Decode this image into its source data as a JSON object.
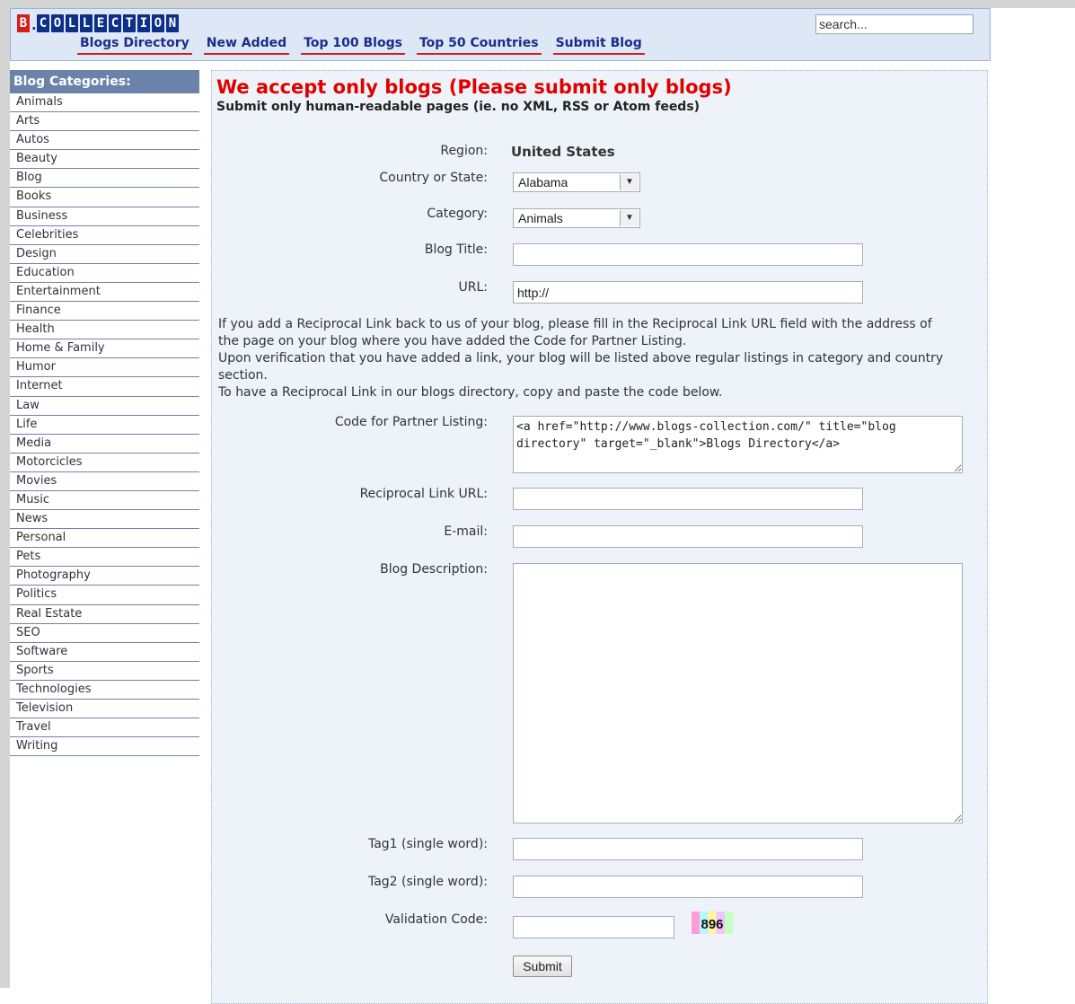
{
  "header": {
    "logo_first": "B",
    "logo_dot": ".",
    "logo_rest": [
      "C",
      "O",
      "L",
      "L",
      "E",
      "C",
      "T",
      "I",
      "O",
      "N"
    ],
    "nav": [
      "Blogs Directory",
      "New Added",
      "Top 100 Blogs",
      "Top 50 Countries",
      "Submit Blog"
    ],
    "search_value": "search..."
  },
  "sidebar": {
    "title": "Blog Categories:",
    "items": [
      "Animals",
      "Arts",
      "Autos",
      "Beauty",
      "Blog",
      "Books",
      "Business",
      "Celebrities",
      "Design",
      "Education",
      "Entertainment",
      "Finance",
      "Health",
      "Home & Family",
      "Humor",
      "Internet",
      "Law",
      "Life",
      "Media",
      "Motorcicles",
      "Movies",
      "Music",
      "News",
      "Personal",
      "Pets",
      "Photography",
      "Politics",
      "Real Estate",
      "SEO",
      "Software",
      "Sports",
      "Technologies",
      "Television",
      "Travel",
      "Writing"
    ]
  },
  "main": {
    "warning": "We accept only blogs (Please submit only blogs)",
    "warning_sub": "Submit only human-readable pages (ie. no XML, RSS or Atom feeds)",
    "labels": {
      "region": "Region:",
      "country": "Country or State:",
      "category": "Category:",
      "blog_title": "Blog Title:",
      "url": "URL:",
      "code": "Code for Partner Listing:",
      "reciprocal": "Reciprocal Link URL:",
      "email": "E-mail:",
      "description": "Blog Description:",
      "tag1": "Tag1 (single word):",
      "tag2": "Tag2 (single word):",
      "validation": "Validation Code:"
    },
    "region_value": "United States",
    "country_value": "Alabama",
    "category_value": "Animals",
    "url_value": "http://",
    "info_lines": [
      "If you add a Reciprocal Link back to us of your blog, please fill in the Reciprocal Link URL field with the address of the page on your blog where you have added the Code for Partner Listing.",
      "Upon verification that you have added a link, your blog will be listed above regular listings in category and country section.",
      "To have a Reciprocal Link in our blogs directory, copy and paste the code below."
    ],
    "code_value": "<a href=\"http://www.blogs-collection.com/\" title=\"blog directory\" target=\"_blank\">Blogs Directory</a>",
    "captcha": "896",
    "submit": "Submit"
  },
  "colors": {
    "warning": "#e00000",
    "nav_text": "#1a2d8a",
    "nav_underline": "#d41d1d",
    "sidebar_header": "#6b83ab",
    "header_bg": "#dde7f5",
    "main_bg": "#eef3f9"
  }
}
